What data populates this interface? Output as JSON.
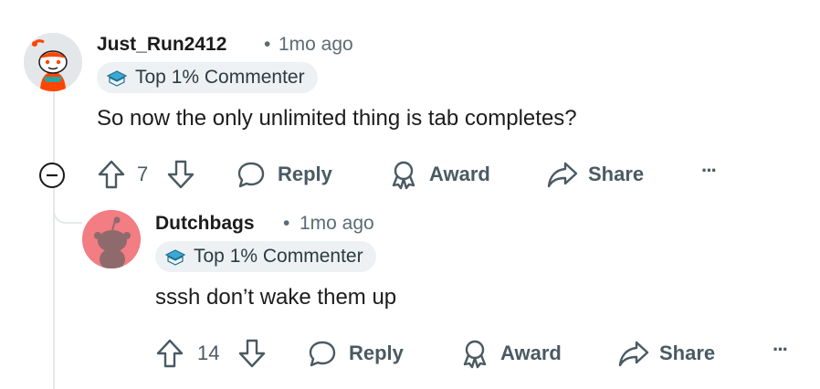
{
  "comments": [
    {
      "username": "Just_Run2412",
      "separator": "•",
      "time": "1mo ago",
      "flair": "Top 1% Commenter",
      "body": "So now the only unlimited thing is tab completes?",
      "votes": "7",
      "reply_label": "Reply",
      "award_label": "Award",
      "share_label": "Share",
      "more_label": "···"
    },
    {
      "username": "Dutchbags",
      "separator": "•",
      "time": "1mo ago",
      "flair": "Top 1% Commenter",
      "body": "sssh don’t wake them up",
      "votes": "14",
      "reply_label": "Reply",
      "award_label": "Award",
      "share_label": "Share",
      "more_label": "···"
    }
  ],
  "colors": {
    "accent_red": "#ff4500",
    "avatar2_bg": "#f27d82",
    "text_secondary": "#5c6c74",
    "badge_bg": "#eef1f3"
  },
  "icons": [
    "upvote-icon",
    "downvote-icon",
    "reply-icon",
    "award-icon",
    "share-icon",
    "more-icon",
    "collapse-icon",
    "flair-icon"
  ]
}
